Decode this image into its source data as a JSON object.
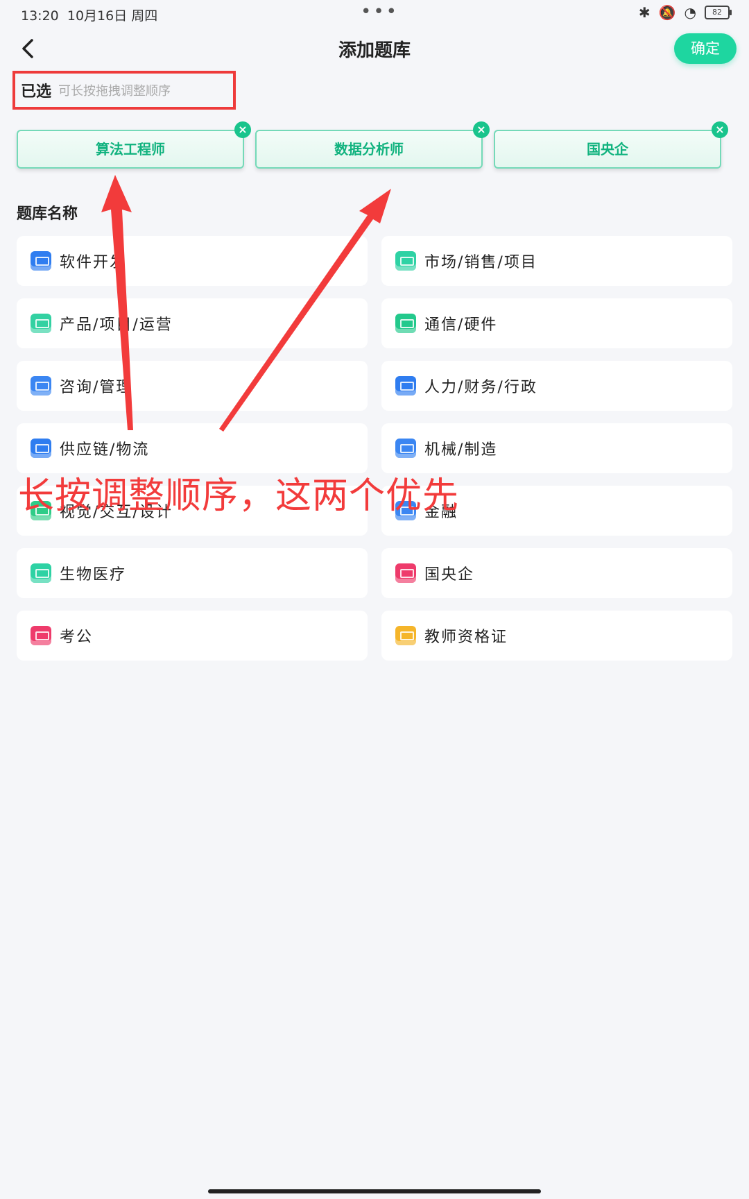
{
  "status_bar": {
    "time": "13:20",
    "date": "10月16日",
    "weekday": "周四",
    "dots": "•••",
    "battery": "82"
  },
  "header": {
    "title": "添加题库",
    "confirm_label": "确定"
  },
  "selected": {
    "label": "已选",
    "hint": "可长按拖拽调整顺序",
    "chips": [
      {
        "label": "算法工程师"
      },
      {
        "label": "数据分析师"
      },
      {
        "label": "国央企"
      }
    ]
  },
  "bank": {
    "title": "题库名称",
    "items": [
      {
        "label": "软件开发",
        "icon": "monitor-icon",
        "color": "#2f7df0"
      },
      {
        "label": "市场/销售/项目",
        "icon": "chart-icon",
        "color": "#2ed2a4"
      },
      {
        "label": "产品/项目/运营",
        "icon": "screen-icon",
        "color": "#33d1a2"
      },
      {
        "label": "通信/硬件",
        "icon": "device-icon",
        "color": "#23c98c"
      },
      {
        "label": "咨询/管理",
        "icon": "list-icon",
        "color": "#3b86f2"
      },
      {
        "label": "人力/财务/行政",
        "icon": "person-icon",
        "color": "#2f7df0"
      },
      {
        "label": "供应链/物流",
        "icon": "truck-icon",
        "color": "#2f7df0"
      },
      {
        "label": "机械/制造",
        "icon": "gear-icon",
        "color": "#3b86f2"
      },
      {
        "label": "视觉/交互/设计",
        "icon": "pencil-icon",
        "color": "#2ecc88"
      },
      {
        "label": "金融",
        "icon": "coin-icon",
        "color": "#3b86f2"
      },
      {
        "label": "生物医疗",
        "icon": "medkit-icon",
        "color": "#2ed2a4"
      },
      {
        "label": "国央企",
        "icon": "flag-icon",
        "color": "#ee3b6b"
      },
      {
        "label": "考公",
        "icon": "badge-icon",
        "color": "#ee3b6b"
      },
      {
        "label": "教师资格证",
        "icon": "certificate-icon",
        "color": "#f5b52a"
      }
    ]
  },
  "annotation": {
    "text": "长按调整顺序，这两个优先",
    "color": "#f23b3b"
  }
}
